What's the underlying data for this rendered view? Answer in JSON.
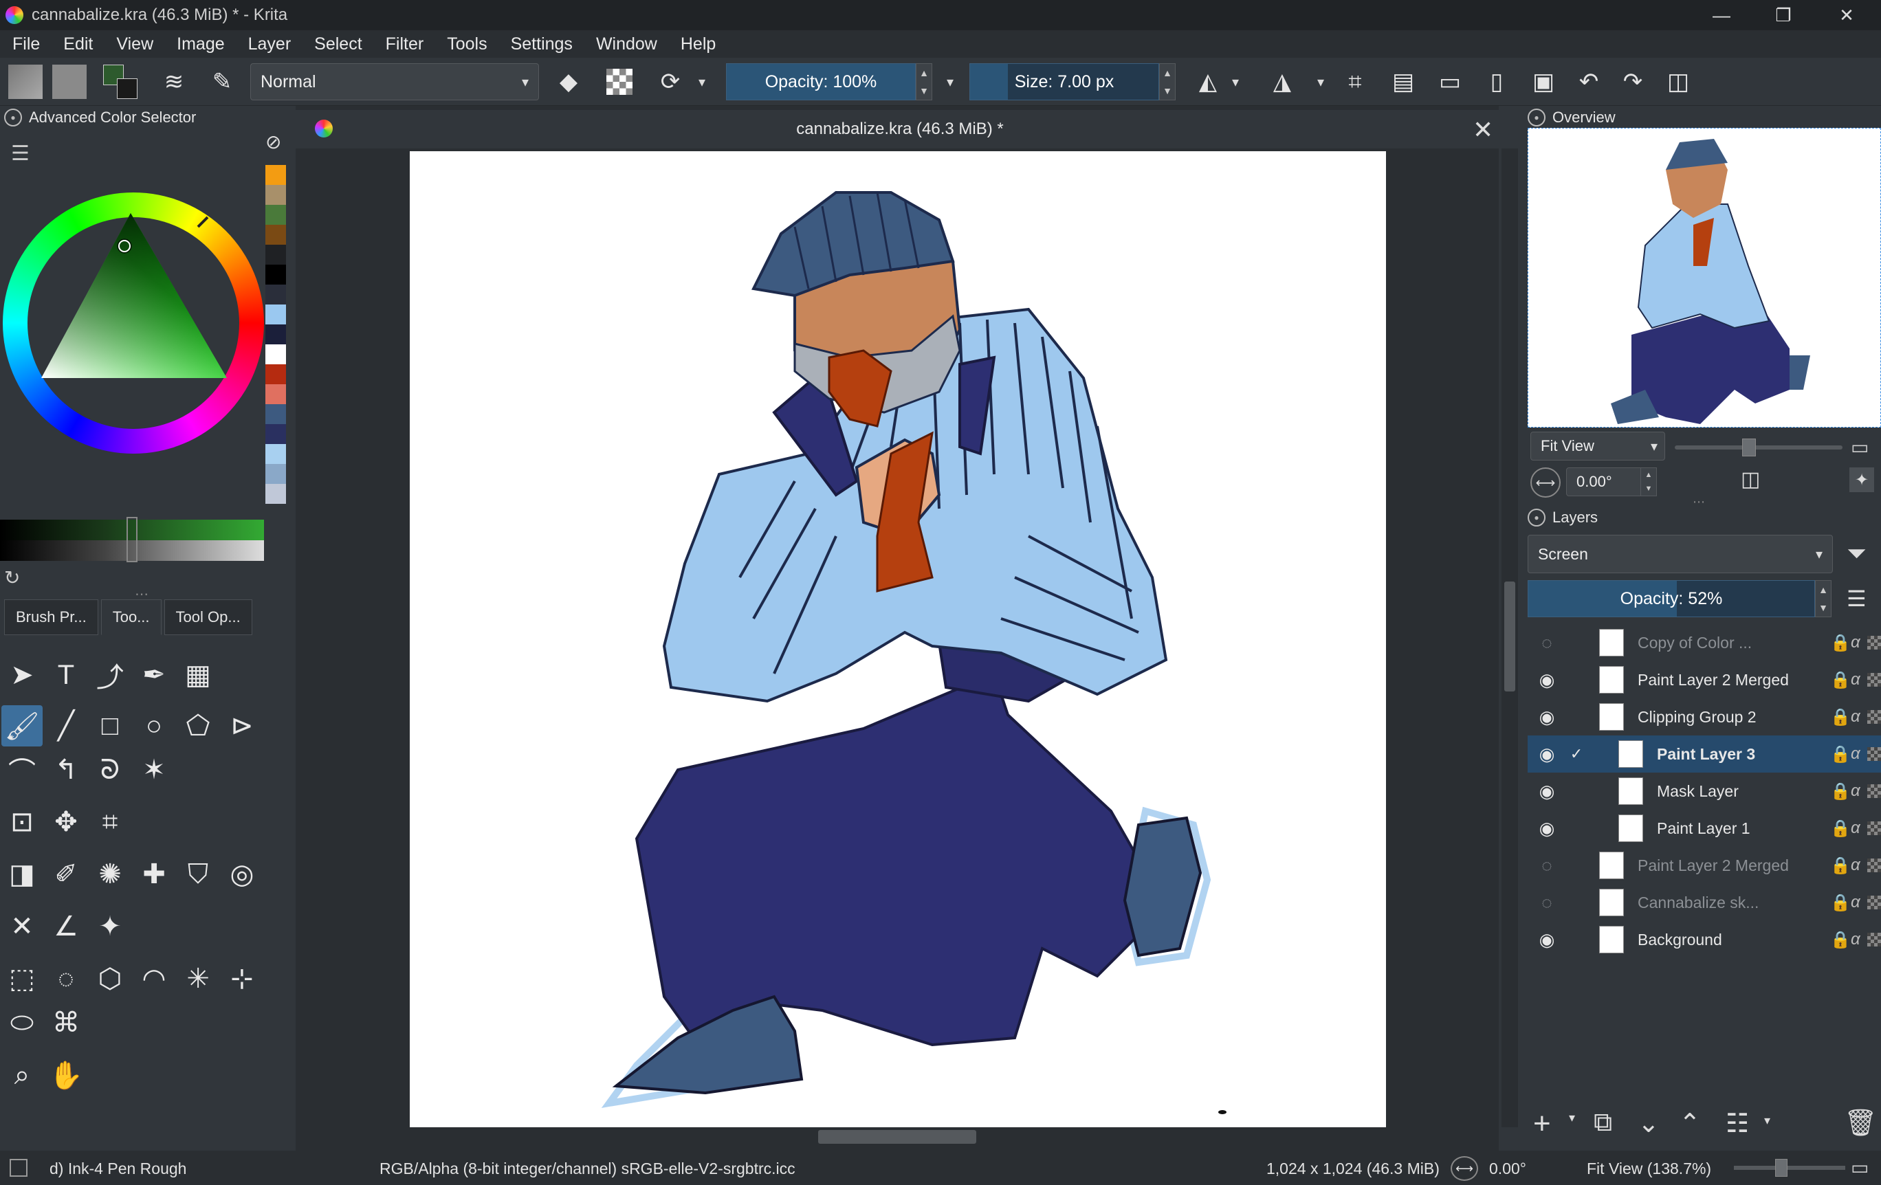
{
  "window": {
    "title": "cannabalize.kra (46.3 MiB) * - Krita"
  },
  "menu": [
    "File",
    "Edit",
    "View",
    "Image",
    "Layer",
    "Select",
    "Filter",
    "Tools",
    "Settings",
    "Window",
    "Help"
  ],
  "toolbar": {
    "blend_mode": "Normal",
    "opacity_label": "Opacity: 100%",
    "opacity_value": 1.0,
    "size_label": "Size: 7.00 px",
    "size_value_fraction": 0.04
  },
  "left_dock": {
    "color_selector_title": "Advanced Color Selector",
    "tabs": [
      "Brush Pr...",
      "Too...",
      "Tool Op..."
    ],
    "swatch_colors": [
      "#f39c12",
      "#a8906a",
      "#4a7a3a",
      "#7a4a14",
      "#1f2124",
      "#000000",
      "#2a2e3a",
      "#9ac8f0",
      "#1b1f3a",
      "#ffffff",
      "#b52b10",
      "#e07060",
      "#3d5a80",
      "#2a3060",
      "#a8d0f0",
      "#8aa8c8",
      "#c0c8d8"
    ]
  },
  "document": {
    "tab_title": "cannabalize.kra (46.3 MiB) *"
  },
  "right_dock": {
    "overview_title": "Overview",
    "zoom_mode": "Fit View",
    "rotation": "0.00°",
    "layers_title": "Layers",
    "layer_blend_mode": "Screen",
    "layer_opacity_label": "Opacity:  52%",
    "layer_opacity_value": 0.52,
    "layers": [
      {
        "name": "Copy of Color ...",
        "visible": false,
        "dim": true,
        "selected": false
      },
      {
        "name": "Paint Layer 2 Merged",
        "visible": true,
        "dim": false,
        "selected": false
      },
      {
        "name": "Clipping Group 2",
        "visible": true,
        "dim": false,
        "selected": false
      },
      {
        "name": "Paint Layer 3",
        "visible": true,
        "dim": false,
        "selected": true
      },
      {
        "name": "Mask Layer",
        "visible": true,
        "dim": false,
        "selected": false
      },
      {
        "name": "Paint Layer 1",
        "visible": true,
        "dim": false,
        "selected": false
      },
      {
        "name": "Paint Layer 2 Merged",
        "visible": false,
        "dim": true,
        "selected": false
      },
      {
        "name": "Cannabalize sk...",
        "visible": false,
        "dim": true,
        "selected": false
      },
      {
        "name": "Background",
        "visible": true,
        "dim": false,
        "selected": false
      }
    ]
  },
  "statusbar": {
    "brush": "d) Ink-4 Pen Rough",
    "color_space": "RGB/Alpha (8-bit integer/channel)  sRGB-elle-V2-srgbtrc.icc",
    "image_size": "1,024 x 1,024 (46.3 MiB)",
    "rotation": "0.00°",
    "zoom": "Fit View (138.7%)"
  }
}
